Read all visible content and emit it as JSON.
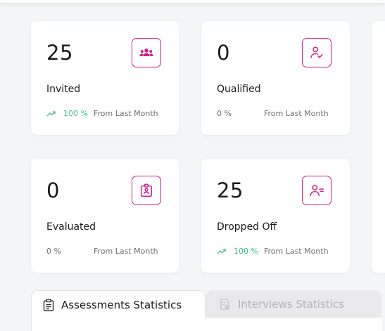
{
  "colors": {
    "accent": "#d01e8a",
    "trend_up": "#3cc08c",
    "background": "#f4f5f7"
  },
  "stats": [
    {
      "value": "25",
      "label": "Invited",
      "trend_pct": "100 %",
      "trend_up": true,
      "trend_note": "From Last Month",
      "icon": "users-group-icon"
    },
    {
      "value": "0",
      "label": "Qualified",
      "trend_pct": "0 %",
      "trend_up": false,
      "trend_note": "From Last Month",
      "icon": "user-check-icon"
    },
    {
      "value": "0",
      "label": "Evaluated",
      "trend_pct": "0 %",
      "trend_up": false,
      "trend_note": "From Last Month",
      "icon": "id-card-icon"
    },
    {
      "value": "25",
      "label": "Dropped Off",
      "trend_pct": "100 %",
      "trend_up": true,
      "trend_note": "From Last Month",
      "icon": "user-minus-icon"
    }
  ],
  "tabs": [
    {
      "label": "Assessments Statistics",
      "active": true,
      "icon": "clipboard-icon"
    },
    {
      "label": "Interviews Statistics",
      "active": false,
      "icon": "document-settings-icon"
    }
  ]
}
